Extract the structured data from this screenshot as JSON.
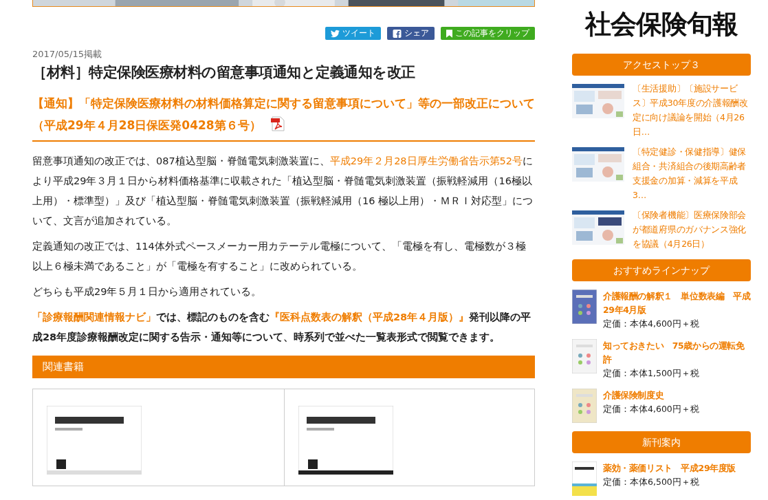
{
  "share_buttons": [
    {
      "kind": "twitter",
      "label": "ツイート"
    },
    {
      "kind": "facebook",
      "label": "シェア"
    },
    {
      "kind": "clip",
      "label": "この記事をクリップ"
    }
  ],
  "article": {
    "date": "2017/05/15掲載",
    "title": "［材料］特定保険医療材料の留意事項通知と定義通知を改正",
    "notice": "【通知】「特定保険医療材料の材料価格算定に関する留意事項について」等の一部改正について（平成29年４月28日保医発0428第６号）",
    "paragraphs": [
      [
        {
          "kind": "text",
          "text": "留意事項通知の改正では、087植込型脳・脊髄電気刺激装置に、"
        },
        {
          "kind": "link",
          "text": "平成29年２月28日厚生労働省告示第52号"
        },
        {
          "kind": "text",
          "text": "により平成29年３月１日から材料価格基準に収載された「植込型脳・脊髄電気刺激装置（振戦軽減用（16極以上用）・標準型）」及び「植込型脳・脊髄電気刺激装置（振戦軽減用（16 極以上用）・ＭＲＩ対応型」について、文言が追加されている。"
        }
      ],
      [
        {
          "kind": "text",
          "text": "定義通知の改正では、114体外式ペースメーカー用カテーテル電極について、「電極を有し、電極数が３極以上６極未満であること」が「電極を有すること」に改められている。"
        }
      ],
      [
        {
          "kind": "text",
          "text": "どちらも平成29年５月１日から適用されている。"
        }
      ]
    ],
    "navi": [
      {
        "kind": "link",
        "text": "「診療報酬関連情報ナビ」"
      },
      {
        "kind": "text",
        "text": "では、標記のものを含む"
      },
      {
        "kind": "link",
        "text": "『医科点数表の解釈（平成28年４月版）』"
      },
      {
        "kind": "text",
        "text": "発刊以降の平成28年度診療報酬改定に関する告示・通知等について、時系列で並べた一覧表形式で閲覧できます。"
      }
    ]
  },
  "related_books": {
    "title": "関連書籍"
  },
  "sidebar": {
    "logo": "社会保険旬報",
    "access_top": {
      "title": "アクセストップ３",
      "items": [
        {
          "text": "〔生活援助〕〔施設サービス〕平成30年度の介護報酬改定に向け議論を開始（4月26日…"
        },
        {
          "text": "〔特定健診・保健指導〕健保組合・共済組合の後期高齢者支援金の加算・減算を平成3…"
        },
        {
          "text": "〔保険者機能〕医療保険部会が都道府県のガバナンス強化を協議（4月26日）"
        }
      ]
    },
    "lineup": {
      "title": "おすすめラインナップ",
      "items": [
        {
          "title": "介護報酬の解釈１　単位数表編　平成29年4月版",
          "price": "定価：本体4,600円＋税"
        },
        {
          "title": "知っておきたい　75歳からの運転免許",
          "price": "定価：本体1,500円＋税"
        },
        {
          "title": "介護保険制度史",
          "price": "定価：本体4,600円＋税"
        }
      ]
    },
    "new_books": {
      "title": "新刊案内",
      "items": [
        {
          "title": "薬効・薬価リスト　平成29年度版",
          "price": "定価：本体6,500円＋税"
        }
      ]
    }
  }
}
